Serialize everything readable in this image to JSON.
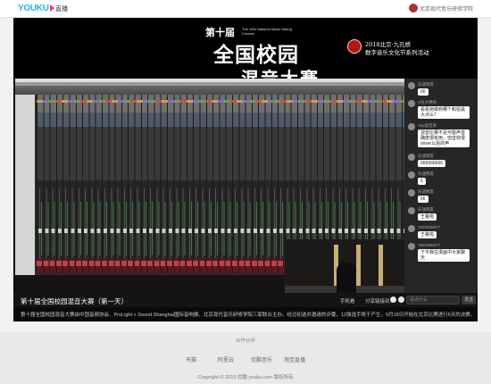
{
  "header": {
    "logo": "YOUKU",
    "channel": "直播",
    "org": "北京现代音乐研修学院"
  },
  "banner": {
    "tenth": "第十届",
    "english": "The 10th National Music Mixing Contest",
    "main": "全国校园",
    "main2": "混音大赛",
    "org_line1": "2018北京·九孔桥",
    "org_line2": "数字音乐文化节系列活动"
  },
  "chat": [
    {
      "user": "乐迷网友",
      "text": "66"
    },
    {
      "user": "V位大神的",
      "text": "看看她做到哪个和弦最大点么？"
    },
    {
      "user": "Yep混音系",
      "text": "混音比赛不足可能声音确度很有用，但音效很mixer以后的声"
    },
    {
      "user": "乐迷网友",
      "text": "666666666"
    },
    {
      "user": "乐迷网友",
      "text": "6"
    },
    {
      "user": "乐迷网友",
      "text": "66"
    },
    {
      "user": "乐迷网友",
      "text": "王羲啦"
    },
    {
      "user": "7820080977",
      "text": "王羲啦"
    },
    {
      "user": "7820080977",
      "text": "下今我在漫画中大家聊天"
    }
  ],
  "stream": {
    "title": "第十届全国校园混音大赛（第一天）",
    "phone_label": "手机看",
    "share_label": "分享链接到：",
    "chat_placeholder": "说点什么",
    "send_label": "发送",
    "description": "第十届全国校园混音大赛由中国音频协会、ProLight + Sound Shanghai国际音响展、北京现代音乐研修学院三家联合主办。经过初选并邀请的评委，12强选手将于产生，9月18日开始在北京比赛进行6天的决赛，欢迎大家前来为年轻选手加油！"
  },
  "footer": {
    "title": "合作伙伴",
    "partners": [
      "天猫",
      "阿里云",
      "优酷音乐",
      "淘宝直播"
    ],
    "copyright": "Copyright © 2019 优酷 youku.com 版权所有"
  },
  "colors": {
    "logo_blue": "#1fb5ff",
    "logo_pink": "#ff3366",
    "stage_black": "#0a0a0a",
    "chat_bg": "#262626"
  }
}
